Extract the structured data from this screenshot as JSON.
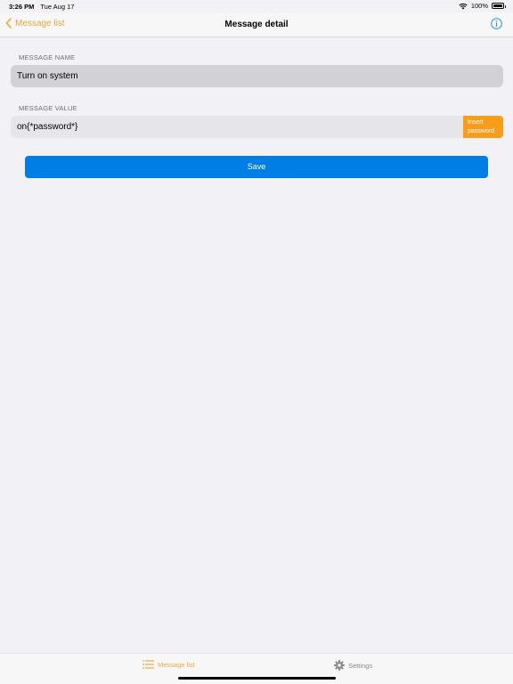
{
  "status": {
    "time": "3:26 PM",
    "date": "Tue Aug 17",
    "battery": "100%"
  },
  "nav": {
    "back_label": "Message list",
    "title": "Message detail"
  },
  "form": {
    "name_label": "MESSAGE NAME",
    "name_value": "Turn on system",
    "value_label": "MESSAGE VALUE",
    "value_value": "on{*password*}",
    "insert_line1": "Insert",
    "insert_line2": "password",
    "save_label": "Save"
  },
  "tabs": [
    {
      "label": "Message list",
      "icon": "list-icon",
      "active": true
    },
    {
      "label": "Settings",
      "icon": "gear-icon",
      "active": false
    }
  ],
  "colors": {
    "accent": "#e9a83a",
    "save": "#007ee5",
    "insert": "#f69d1b",
    "info": "#2f8fd8"
  }
}
